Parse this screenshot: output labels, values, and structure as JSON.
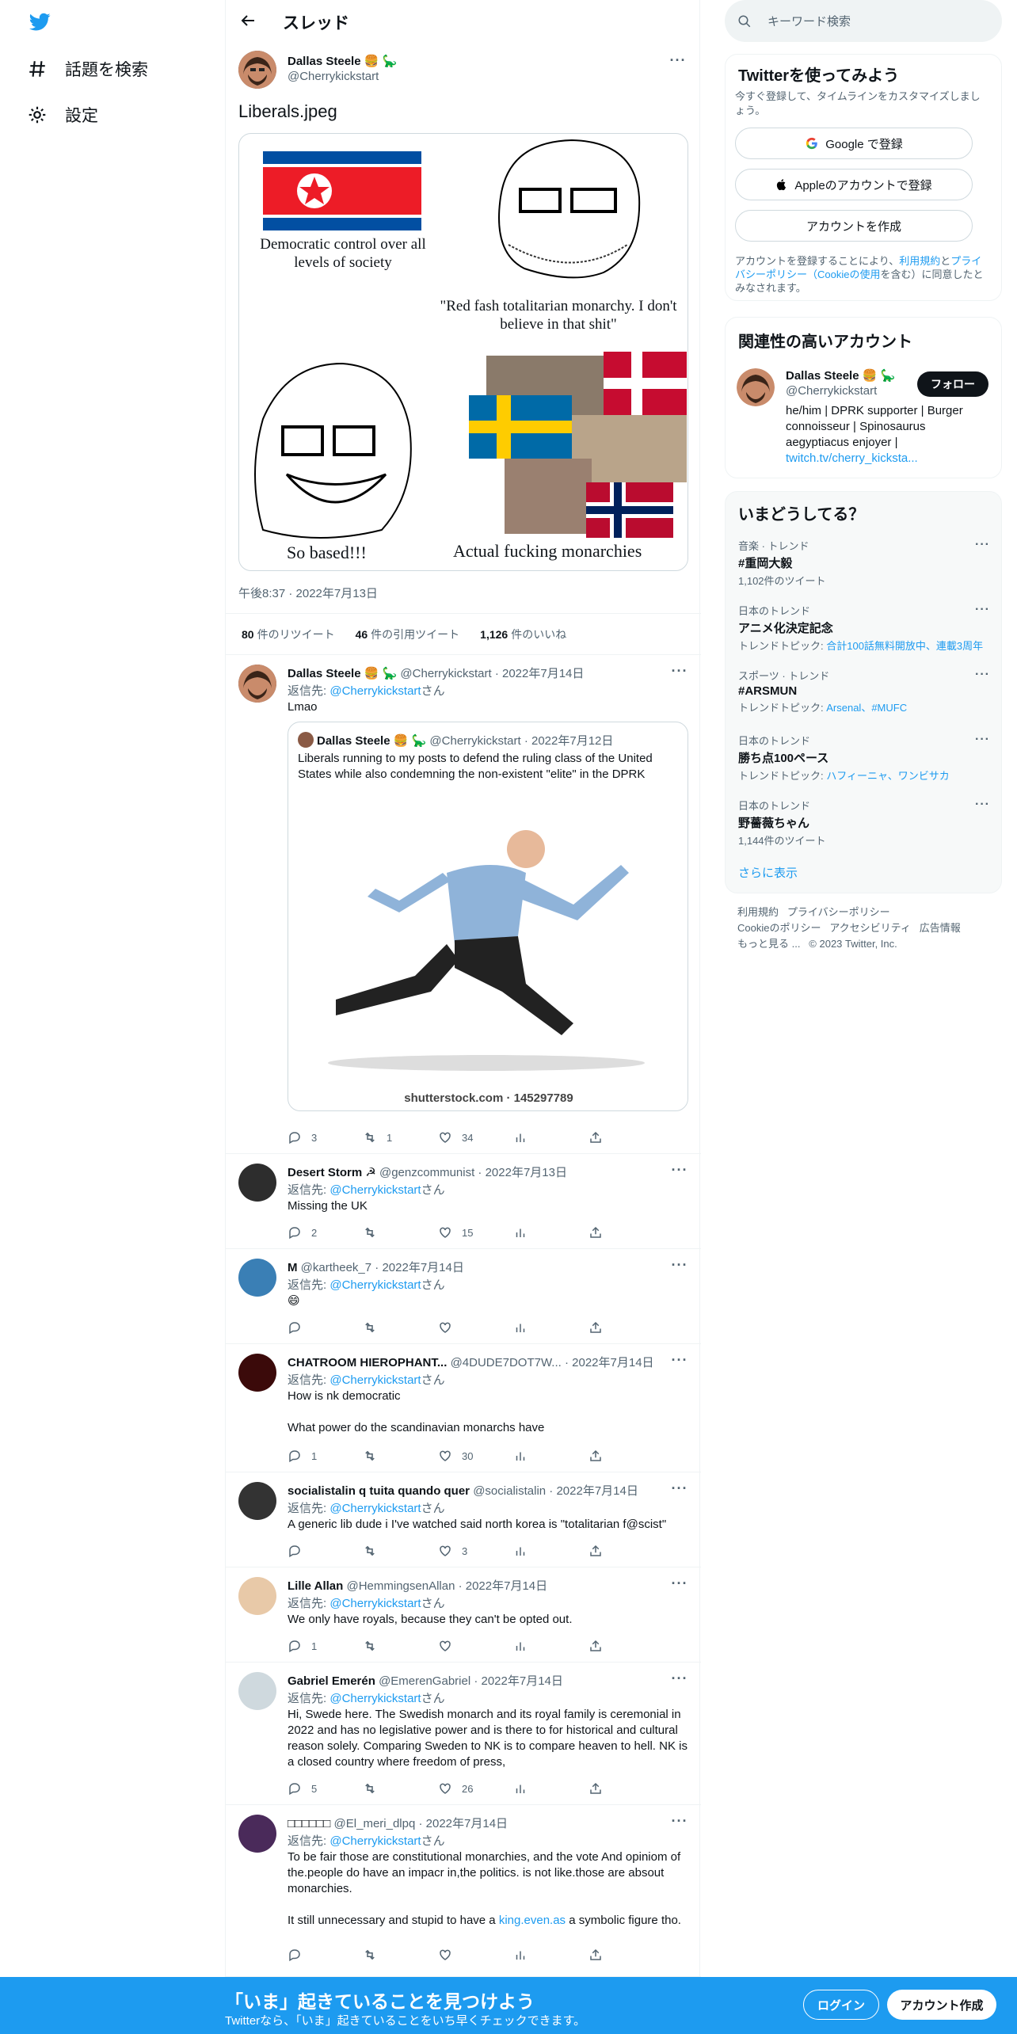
{
  "nav": {
    "explore_label": "話題を検索",
    "settings_label": "設定"
  },
  "header": {
    "title": "スレッド"
  },
  "main_tweet": {
    "name": "Dallas Steele 🍔 🦕",
    "handle": "@Cherrykickstart",
    "text": "Liberals.jpeg",
    "image_texts": {
      "nk_caption": "Democratic control over all levels of society",
      "wojak_caption": "\"Red fash totalitarian monarchy. I don't believe in that shit\"",
      "soyjak_caption": "So based!!!",
      "monarchies_caption": "Actual fucking monarchies"
    },
    "timestamp": "午後8:37 · 2022年7月13日",
    "retweets_count": "80",
    "retweets_label": "件のリツイート",
    "quotes_count": "46",
    "quotes_label": "件の引用ツイート",
    "likes_count": "1,126",
    "likes_label": "件のいいね"
  },
  "replies": [
    {
      "name": "Dallas Steele 🍔 🦕",
      "meta": "@Cherrykickstart · 2022年7月14日",
      "reply_to_prefix": "返信先: ",
      "reply_to_handle": "@Cherrykickstart",
      "reply_to_suffix": "さん",
      "text": "Lmao",
      "quote": {
        "name": "Dallas Steele 🍔 🦕",
        "meta": "@Cherrykickstart · 2022年7月12日",
        "text": "Liberals running to my posts to defend the ruling class of the United States while also condemning the non-existent \"elite\" in the DPRK",
        "watermark": "shutterstock.com · 145297789"
      },
      "replies_count": "3",
      "retweets_count": "1",
      "likes_count": "34"
    },
    {
      "name": "Desert Storm ☭",
      "meta": "@genzcommunist · 2022年7月13日",
      "reply_to_prefix": "返信先: ",
      "reply_to_handle": "@Cherrykickstart",
      "reply_to_suffix": "さん",
      "text": "Missing the UK",
      "replies_count": "2",
      "retweets_count": "",
      "likes_count": "15"
    },
    {
      "name": "M",
      "meta": "@kartheek_7 · 2022年7月14日",
      "reply_to_prefix": "返信先: ",
      "reply_to_handle": "@Cherrykickstart",
      "reply_to_suffix": "さん",
      "text": "😄",
      "replies_count": "",
      "retweets_count": "",
      "likes_count": ""
    },
    {
      "name": "CHATROOM HIEROPHANT...",
      "meta": "@4DUDE7DOT7W... · 2022年7月14日",
      "reply_to_prefix": "返信先: ",
      "reply_to_handle": "@Cherrykickstart",
      "reply_to_suffix": "さん",
      "text": "How is nk democratic",
      "text2": "What power do the scandinavian monarchs have",
      "replies_count": "1",
      "retweets_count": "",
      "likes_count": "30"
    },
    {
      "name": "socialistalin q tuita quando quer",
      "meta": "@socialistalin · 2022年7月14日",
      "reply_to_prefix": "返信先: ",
      "reply_to_handle": "@Cherrykickstart",
      "reply_to_suffix": "さん",
      "text": "A generic lib dude i I've watched said north korea is \"totalitarian f@scist\"",
      "replies_count": "",
      "retweets_count": "",
      "likes_count": "3"
    },
    {
      "name": "Lille Allan",
      "meta": "@HemmingsenAllan · 2022年7月14日",
      "reply_to_prefix": "返信先: ",
      "reply_to_handle": "@Cherrykickstart",
      "reply_to_suffix": "さん",
      "text": "We only have royals, because they can't be opted out.",
      "replies_count": "1",
      "retweets_count": "",
      "likes_count": ""
    },
    {
      "name": "Gabriel Emerén",
      "meta": "@EmerenGabriel · 2022年7月14日",
      "reply_to_prefix": "返信先: ",
      "reply_to_handle": "@Cherrykickstart",
      "reply_to_suffix": "さん",
      "text": "Hi, Swede here. The Swedish monarch and its royal family is ceremonial in 2022 and has no legislative power and is there to for historical and cultural reason solely. Comparing Sweden to NK is to compare heaven to hell. NK is a closed country where freedom of press,",
      "replies_count": "5",
      "retweets_count": "",
      "likes_count": "26"
    },
    {
      "name": "□□□□□□",
      "meta": "@El_meri_dlpq · 2022年7月14日",
      "reply_to_prefix": "返信先: ",
      "reply_to_handle": "@Cherrykickstart",
      "reply_to_suffix": "さん",
      "text": "To be fair those are constitutional monarchies, and the vote And opiniom of the.people do have an impacr in,the politics. is not like.those are absout monarchies.",
      "text2_a": "It still unnecessary and stupid to have a ",
      "text2_link": "king.even.as",
      "text2_b": " a symbolic figure tho.",
      "replies_count": "",
      "retweets_count": "",
      "likes_count": ""
    }
  ],
  "sidebar": {
    "search_placeholder": "キーワード検索",
    "signup_card": {
      "title": "Twitterを使ってみよう",
      "subtitle": "今すぐ登録して、タイムラインをカスタマイズしましょう。",
      "google_label": "Google で登録",
      "apple_label": "Appleのアカウントで登録",
      "create_label": "アカウントを作成",
      "legal_prefix": "アカウントを登録することにより、",
      "legal_terms": "利用規約",
      "legal_and": "と",
      "legal_privacy": "プライバシーポリシー",
      "legal_cookie": "（Cookieの使用",
      "legal_suffix": "を含む）に同意したとみなされます。"
    },
    "related": {
      "title": "関連性の高いアカウント",
      "name": "Dallas Steele 🍔 🦕",
      "handle": "@Cherrykickstart",
      "follow_label": "フォロー",
      "bio": "he/him | DPRK supporter | Burger connoisseur | Spinosaurus aegyptiacus enjoyer |",
      "bio_link": "twitch.tv/cherry_kicksta..."
    },
    "trends": {
      "title": "いまどうしてる？",
      "items": [
        {
          "category": "音楽 · トレンド",
          "topic": "#重岡大毅",
          "sub": "1,102件のツイート"
        },
        {
          "category": "日本のトレンド",
          "topic": "アニメ化決定記念",
          "sub_prefix": "トレンドトピック: ",
          "sub_links": "合計100話無料開放中、連載3周年"
        },
        {
          "category": "スポーツ · トレンド",
          "topic": "#ARSMUN",
          "sub_prefix": "トレンドトピック: ",
          "sub_links": "Arsenal、#MUFC"
        },
        {
          "category": "日本のトレンド",
          "topic": "勝ち点100ペース",
          "sub_prefix": "トレンドトピック: ",
          "sub_links": "ハフィーニャ、ワンビサカ"
        },
        {
          "category": "日本のトレンド",
          "topic": "野薔薇ちゃん",
          "sub": "1,144件のツイート"
        }
      ],
      "show_more": "さらに表示"
    },
    "footer": {
      "line1_a": "利用規約",
      "line1_b": "プライバシーポリシー",
      "line2_a": "Cookieのポリシー",
      "line2_b": "アクセシビリティ",
      "line2_c": "広告情報",
      "line3_a": "もっと見る ...",
      "line3_b": "© 2023 Twitter, Inc."
    }
  },
  "bottom_bar": {
    "headline": "「いま」起きていることを見つけよう",
    "sub": "Twitterなら、「いま」起きていることをいち早くチェックできます。",
    "login_label": "ログイン",
    "signup_label": "アカウント作成"
  },
  "colors": {
    "accent": "#1d9bf0",
    "text": "#0f1419",
    "muted": "#536471",
    "border": "#eff3f4"
  }
}
